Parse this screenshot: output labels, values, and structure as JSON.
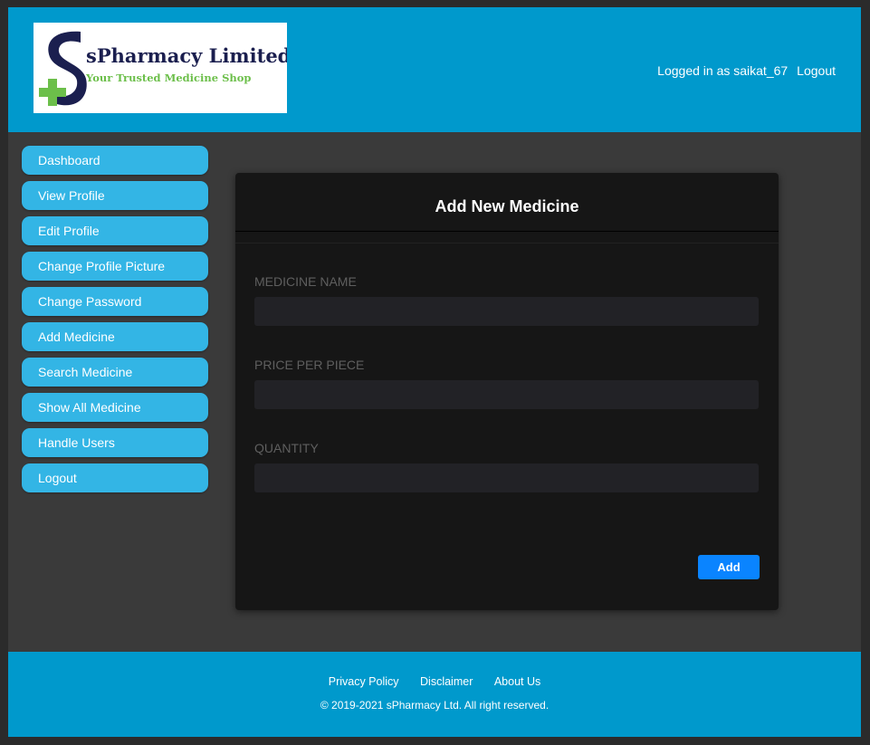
{
  "brand": {
    "name": "sPharmacy Limited",
    "tagline": "Your Trusted Medicine Shop",
    "logo_colors": {
      "s": "#1b1f4f",
      "cross": "#6cbf4a"
    }
  },
  "header": {
    "logged_in_text": "Logged in as saikat_67",
    "logout_label": "Logout"
  },
  "sidebar": {
    "items": [
      {
        "label": "Dashboard"
      },
      {
        "label": "View Profile"
      },
      {
        "label": "Edit Profile"
      },
      {
        "label": "Change Profile Picture"
      },
      {
        "label": "Change Password"
      },
      {
        "label": "Add Medicine"
      },
      {
        "label": "Search Medicine"
      },
      {
        "label": "Show All Medicine"
      },
      {
        "label": "Handle Users"
      },
      {
        "label": "Logout"
      }
    ]
  },
  "form": {
    "title": "Add New Medicine",
    "fields": [
      {
        "label": "MEDICINE NAME",
        "value": ""
      },
      {
        "label": "PRICE PER PIECE",
        "value": ""
      },
      {
        "label": "QUANTITY",
        "value": ""
      }
    ],
    "submit_label": "Add"
  },
  "footer": {
    "links": [
      "Privacy Policy",
      "Disclaimer",
      "About Us"
    ],
    "copyright": "© 2019-2021 sPharmacy Ltd. All right reserved."
  },
  "colors": {
    "header_bg": "#0099cc",
    "nav_bg": "#33b5e5",
    "card_bg": "#161616",
    "button_bg": "#0a84ff"
  }
}
